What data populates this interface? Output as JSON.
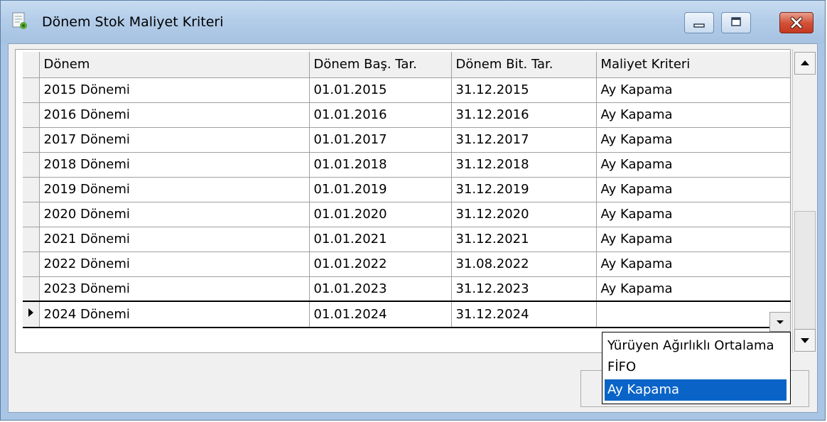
{
  "window": {
    "title": "Dönem Stok Maliyet Kriteri",
    "app_icon": "report-doc-icon",
    "controls": [
      "minimize-icon",
      "maximize-icon",
      "close-icon"
    ]
  },
  "grid": {
    "columns": [
      "Dönem",
      "Dönem Baş. Tar.",
      "Dönem Bit. Tar.",
      "Maliyet Kriteri"
    ],
    "rows": [
      {
        "period": "2015 Dönemi",
        "start": "01.01.2015",
        "end": "31.12.2015",
        "criterion": "Ay Kapama"
      },
      {
        "period": "2016 Dönemi",
        "start": "01.01.2016",
        "end": "31.12.2016",
        "criterion": "Ay Kapama"
      },
      {
        "period": "2017 Dönemi",
        "start": "01.01.2017",
        "end": "31.12.2017",
        "criterion": "Ay Kapama"
      },
      {
        "period": "2018 Dönemi",
        "start": "01.01.2018",
        "end": "31.12.2018",
        "criterion": "Ay Kapama"
      },
      {
        "period": "2019 Dönemi",
        "start": "01.01.2019",
        "end": "31.12.2019",
        "criterion": "Ay Kapama"
      },
      {
        "period": "2020 Dönemi",
        "start": "01.01.2020",
        "end": "31.12.2020",
        "criterion": "Ay Kapama"
      },
      {
        "period": "2021 Dönemi",
        "start": "01.01.2021",
        "end": "31.12.2021",
        "criterion": "Ay Kapama"
      },
      {
        "period": "2022 Dönemi",
        "start": "01.01.2022",
        "end": "31.08.2022",
        "criterion": "Ay Kapama"
      },
      {
        "period": "2023 Dönemi",
        "start": "01.01.2023",
        "end": "31.12.2023",
        "criterion": "Ay Kapama"
      },
      {
        "period": "2024 Dönemi",
        "start": "01.01.2024",
        "end": "31.12.2024",
        "criterion": ""
      }
    ],
    "current_row_index": 9
  },
  "dropdown": {
    "options": [
      "Yürüyen Ağırlıklı Ortalama",
      "FİFO",
      "Ay Kapama"
    ],
    "selected": "Ay Kapama"
  },
  "colors": {
    "titlebar": "#b3cde9",
    "selection": "#0a64c8",
    "close_button": "#c4381f"
  }
}
